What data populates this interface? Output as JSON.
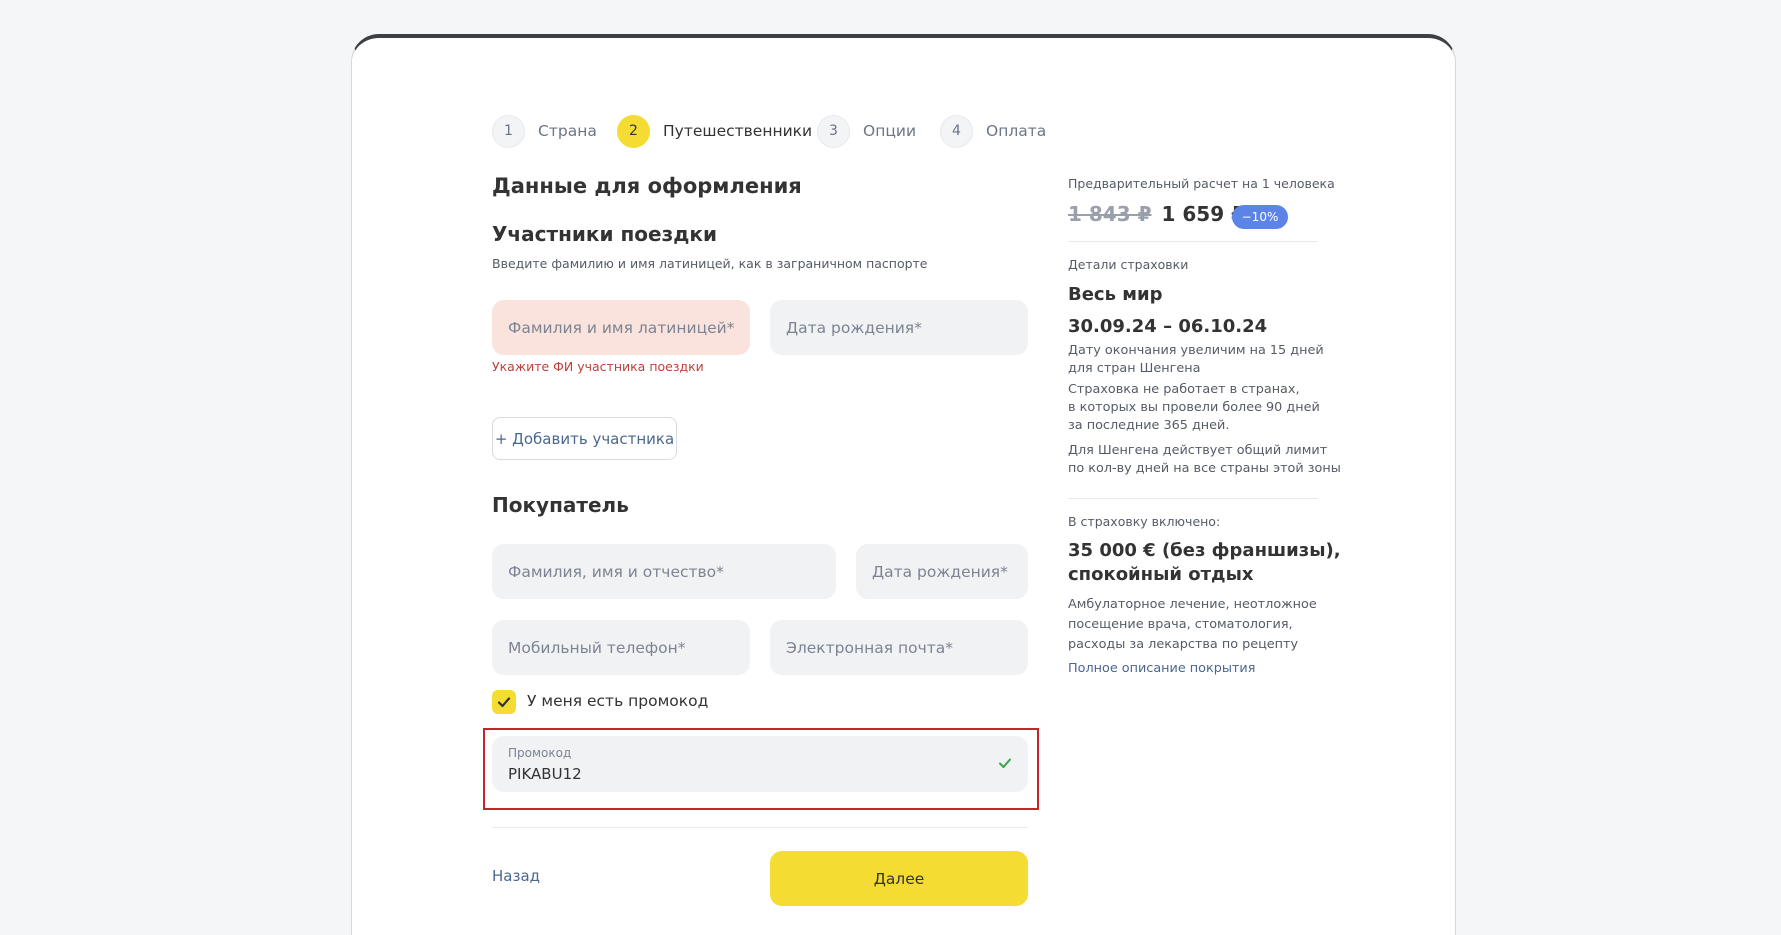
{
  "stepper": [
    {
      "num": "1",
      "label": "Страна"
    },
    {
      "num": "2",
      "label": "Путешественники"
    },
    {
      "num": "3",
      "label": "Опции"
    },
    {
      "num": "4",
      "label": "Оплата"
    }
  ],
  "form": {
    "title": "Данные для оформления",
    "participants": {
      "title": "Участники поездки",
      "hint": "Введите фамилию и имя латиницей, как в заграничном паспорте",
      "name_placeholder": "Фамилия и имя латиницей*",
      "dob_placeholder": "Дата рождения*",
      "error": "Укажите ФИ участника поездки",
      "add_button": "+ Добавить участника"
    },
    "buyer": {
      "title": "Покупатель",
      "fullname_placeholder": "Фамилия, имя и отчество*",
      "dob_placeholder": "Дата рождения*",
      "phone_placeholder": "Мобильный телефон*",
      "email_placeholder": "Электронная почта*"
    },
    "promo": {
      "checkbox_label": "У меня есть промокод",
      "checked": true,
      "field_label": "Промокод",
      "value": "PIKABU12"
    },
    "back_label": "Назад",
    "next_label": "Далее"
  },
  "summary": {
    "estimate_label": "Предварительный расчет на 1 человека",
    "old_price": "1 843 ₽",
    "new_price": "1 659 ₽",
    "discount": "−10%",
    "details_label": "Детали страховки",
    "region": "Весь мир",
    "dates": "30.09.24 – 06.10.24",
    "note_1_line_1": "Дату окончания увеличим на 15 дней",
    "note_1_line_2": "для стран Шенгена",
    "note_2_line_1": "Страховка не работает в странах,",
    "note_2_line_2": "в которых вы провели более 90 дней",
    "note_2_line_3": "за последние 365 дней.",
    "note_3_line_1": "Для Шенгена действует общий лимит",
    "note_3_line_2": "по кол-ву дней на все страны этой зоны",
    "included_label": "В страховку включено:",
    "coverage_line_1": "35 000 € (без франшизы),",
    "coverage_line_2": "спокойный отдых",
    "coverage_desc_line_1": "Амбулаторное лечение, неотложное",
    "coverage_desc_line_2": "посещение врача, стоматология,",
    "coverage_desc_line_3": "расходы за лекарства по рецепту",
    "full_link": "Полное описание покрытия"
  },
  "colors": {
    "accent_yellow": "#f5dc32",
    "badge_blue": "#5c84e6",
    "error_bg": "#fbe3dd",
    "error_text": "#b8433c",
    "highlight_red": "#c5252a",
    "link_blue": "#4a6790"
  }
}
